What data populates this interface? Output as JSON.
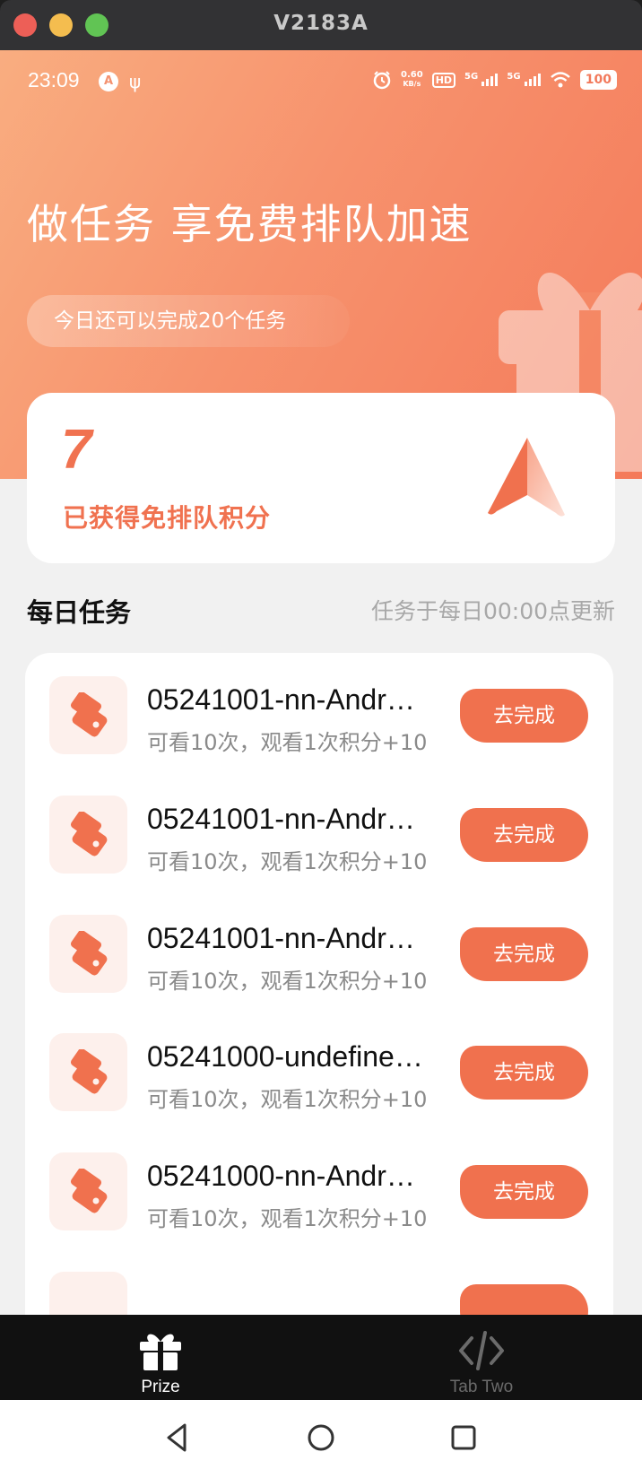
{
  "window": {
    "title": "V2183A"
  },
  "status_bar": {
    "time": "23:09",
    "network_speed_value": "0.60",
    "network_speed_unit": "KB/s",
    "hd": "HD",
    "signal_1": "5G",
    "signal_2": "5G",
    "battery": "100"
  },
  "hero": {
    "title": "做任务 享免费排队加速",
    "quota_text": "今日还可以完成20个任务"
  },
  "points": {
    "value": "7",
    "label": "已获得免排队积分"
  },
  "daily": {
    "title": "每日任务",
    "note": "任务于每日00:00点更新"
  },
  "tasks": [
    {
      "title": "05241001-nn-Andr…",
      "subtitle": "可看10次，观看1次积分+10",
      "button": "去完成"
    },
    {
      "title": "05241001-nn-Andr…",
      "subtitle": "可看10次，观看1次积分+10",
      "button": "去完成"
    },
    {
      "title": "05241001-nn-Andr…",
      "subtitle": "可看10次，观看1次积分+10",
      "button": "去完成"
    },
    {
      "title": "05241000-undefine…",
      "subtitle": "可看10次，观看1次积分+10",
      "button": "去完成"
    },
    {
      "title": "05241000-nn-Andr…",
      "subtitle": "可看10次，观看1次积分+10",
      "button": "去完成"
    }
  ],
  "tabbar": {
    "tabs": [
      {
        "label": "Prize",
        "icon": "gift-icon",
        "active": true
      },
      {
        "label": "Tab Two",
        "icon": "code-icon",
        "active": false
      }
    ]
  },
  "nav": {
    "back": "back-icon",
    "home": "home-icon",
    "recents": "recents-icon"
  },
  "colors": {
    "accent": "#f0714e",
    "hero_start": "#f9ad80",
    "hero_end": "#f47a5a",
    "tabbar_bg": "#111111"
  }
}
